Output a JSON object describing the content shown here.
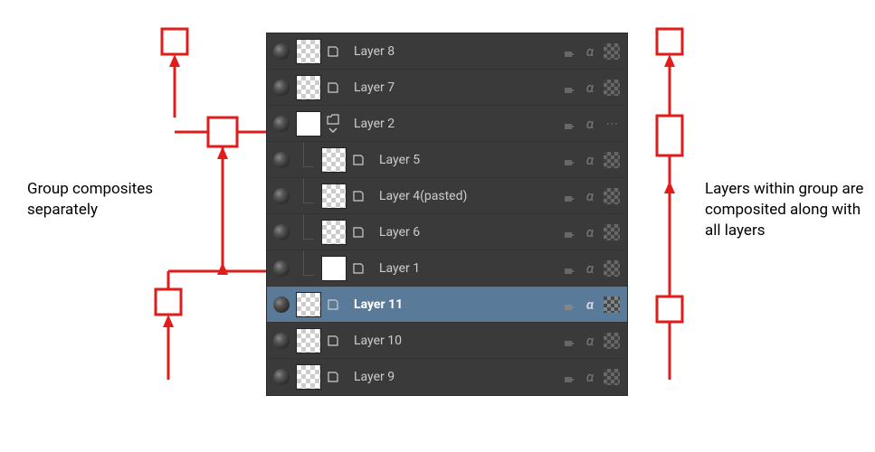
{
  "annotations": {
    "left": "Group composites separately",
    "right": "Layers within group are composited along with all layers"
  },
  "panel": {
    "rows": [
      {
        "name": "Layer 8",
        "indent": 0,
        "thumb": "trans",
        "group": false,
        "selected": false,
        "maskStyle": "check"
      },
      {
        "name": "Layer 7",
        "indent": 0,
        "thumb": "trans",
        "group": false,
        "selected": false,
        "maskStyle": "check"
      },
      {
        "name": "Layer 2",
        "indent": 0,
        "thumb": "solid",
        "group": true,
        "selected": false,
        "maskStyle": "dots",
        "expanded": true
      },
      {
        "name": "Layer 5",
        "indent": 1,
        "thumb": "trans",
        "group": false,
        "selected": false,
        "maskStyle": "check"
      },
      {
        "name": "Layer 4(pasted)",
        "indent": 1,
        "thumb": "trans",
        "group": false,
        "selected": false,
        "maskStyle": "check"
      },
      {
        "name": "Layer 6",
        "indent": 1,
        "thumb": "trans",
        "group": false,
        "selected": false,
        "maskStyle": "check"
      },
      {
        "name": "Layer 1",
        "indent": 1,
        "thumb": "solid",
        "group": false,
        "selected": false,
        "maskStyle": "check"
      },
      {
        "name": "Layer 11",
        "indent": 0,
        "thumb": "trans",
        "group": false,
        "selected": true,
        "maskStyle": "check"
      },
      {
        "name": "Layer 10",
        "indent": 0,
        "thumb": "trans",
        "group": false,
        "selected": false,
        "maskStyle": "check"
      },
      {
        "name": "Layer 9",
        "indent": 0,
        "thumb": "trans",
        "group": false,
        "selected": false,
        "maskStyle": "check"
      }
    ]
  },
  "colors": {
    "redStroke": "#e21b1b",
    "panelBg": "#3a3a3a",
    "selectedBg": "#5a7a9a"
  }
}
